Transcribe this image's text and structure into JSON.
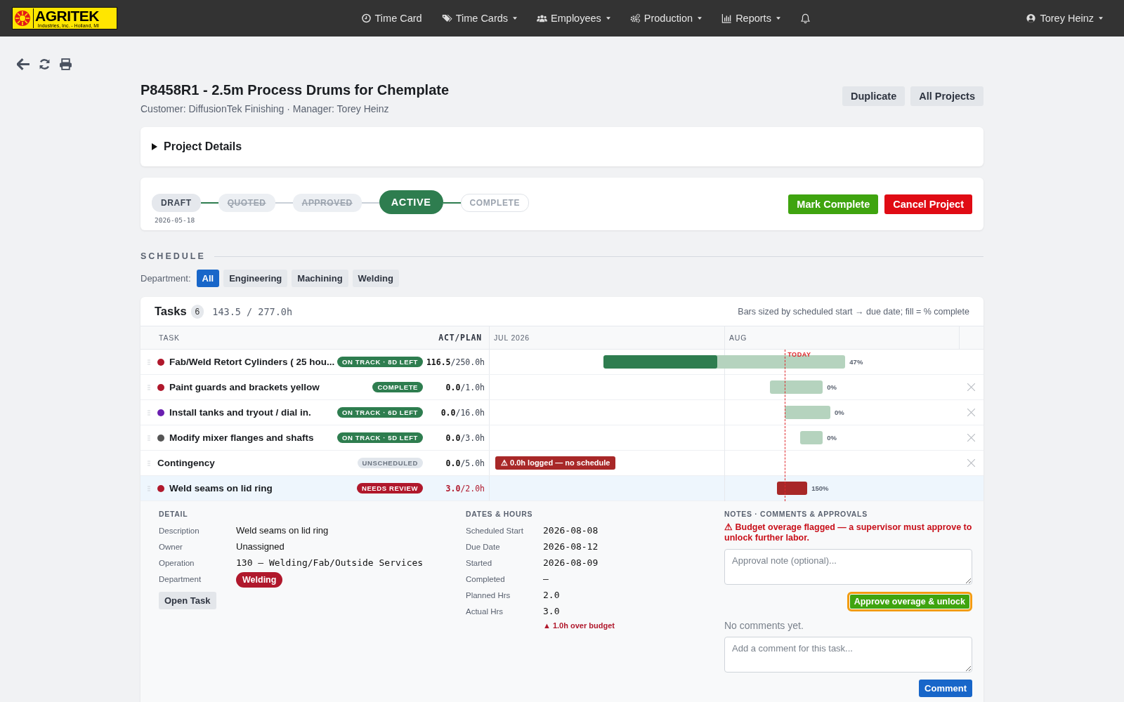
{
  "nav": {
    "logo": {
      "name": "AGRITEK",
      "tagline": "Industries, Inc. - Holland, MI"
    },
    "items": [
      {
        "label": "Time Card",
        "has_menu": false
      },
      {
        "label": "Time Cards",
        "has_menu": true
      },
      {
        "label": "Employees",
        "has_menu": true
      },
      {
        "label": "Production",
        "has_menu": true
      },
      {
        "label": "Reports",
        "has_menu": true
      }
    ],
    "user": {
      "name": "Torey Heinz",
      "has_menu": true
    }
  },
  "project": {
    "title": "P8458R1 - 2.5m Process Drums for Chemplate",
    "subtitle": "Customer: DiffusionTek Finishing · Manager: Torey Heinz",
    "actions": [
      "Duplicate",
      "All Projects"
    ]
  },
  "details": {
    "label": "Project Details",
    "expanded": false
  },
  "workflow": {
    "steps": [
      {
        "label": "DRAFT",
        "completed": true,
        "skipped": false,
        "current": false,
        "date": "2026-05-18"
      },
      {
        "label": "QUOTED",
        "completed": false,
        "skipped": true,
        "current": false
      },
      {
        "label": "APPROVED",
        "completed": false,
        "skipped": true,
        "current": false
      },
      {
        "label": "ACTIVE",
        "completed": false,
        "skipped": false,
        "current": true
      },
      {
        "label": "COMPLETE",
        "completed": false,
        "skipped": false,
        "current": false
      }
    ],
    "actions": [
      {
        "label": "Mark Complete",
        "kind": "success"
      },
      {
        "label": "Cancel Project",
        "kind": "danger"
      }
    ]
  },
  "schedule": {
    "heading": "SCHEDULE",
    "filter_label": "Department:",
    "filters": [
      {
        "label": "All",
        "selected": true
      },
      {
        "label": "Engineering",
        "selected": false
      },
      {
        "label": "Machining",
        "selected": false
      },
      {
        "label": "Welding",
        "selected": false
      }
    ]
  },
  "tasks": {
    "title": "Tasks",
    "count": "6",
    "hours": "143.5 / 277.0h",
    "legend": "Bars sized by scheduled start → due date; fill = % complete",
    "columns": {
      "task": "TASK",
      "hours": "ACT/PLAN"
    },
    "timeline": {
      "today_label": "TODAY",
      "months": [
        "JUL 2026",
        "AUG"
      ]
    },
    "rows": [
      {
        "name": "Fab/Weld Retort Cylinders ( 25 hou...",
        "color": "#b0182c",
        "status": {
          "label": "ON TRACK · 8D LEFT",
          "kind": "on-track"
        },
        "actual": "116.5",
        "plan": "/250.0h",
        "over_budget": false,
        "bar": {
          "level": 0.47,
          "kind": "progress"
        },
        "percent": "47%",
        "removable": false,
        "selected": false
      },
      {
        "name": "Paint guards and brackets yellow",
        "color": "#b0182c",
        "status": {
          "label": "COMPLETE",
          "kind": "complete"
        },
        "actual": "0.0",
        "plan": "/1.0h",
        "over_budget": false,
        "bar": {
          "level": 0,
          "kind": "progress"
        },
        "percent": "0%",
        "removable": true,
        "selected": false
      },
      {
        "name": "Install tanks and tryout / dial in.",
        "color": "#6a1fb0",
        "status": {
          "label": "ON TRACK · 6D LEFT",
          "kind": "on-track"
        },
        "actual": "0.0",
        "plan": "/16.0h",
        "over_budget": false,
        "bar": {
          "level": 0,
          "kind": "progress"
        },
        "percent": "0%",
        "removable": true,
        "selected": false
      },
      {
        "name": "Modify mixer flanges and shafts",
        "color": "#555555",
        "status": {
          "label": "ON TRACK · 5D LEFT",
          "kind": "on-track"
        },
        "actual": "0.0",
        "plan": "/3.0h",
        "over_budget": false,
        "bar": {
          "level": 0,
          "kind": "progress"
        },
        "percent": "0%",
        "removable": true,
        "selected": false
      },
      {
        "name": "Contingency",
        "status": {
          "label": "UNSCHEDULED",
          "kind": "unscheduled"
        },
        "actual": "0.0",
        "plan": "/5.0h",
        "over_budget": false,
        "warning": "⚠ 0.0h logged — no schedule",
        "removable": true,
        "selected": false
      },
      {
        "name": "Weld seams on lid ring",
        "color": "#b0182c",
        "status": {
          "label": "NEEDS REVIEW",
          "kind": "review"
        },
        "actual": "3.0",
        "plan": "/2.0h",
        "over_budget": true,
        "bar": {
          "level": 1,
          "kind": "over"
        },
        "percent": "150%",
        "removable": false,
        "selected": true
      }
    ]
  },
  "detail": {
    "heading": "DETAIL",
    "fields": [
      {
        "label": "Description",
        "value": "Weld seams on lid ring",
        "kind": "text"
      },
      {
        "label": "Owner",
        "value": "Unassigned",
        "kind": "text"
      },
      {
        "label": "Operation",
        "value": "130 – Welding/Fab/Outside Services",
        "kind": "mono"
      },
      {
        "label": "Department",
        "value": "Welding",
        "kind": "tag"
      }
    ],
    "button": "Open Task"
  },
  "dates": {
    "heading": "DATES & HOURS",
    "fields": [
      {
        "label": "Scheduled Start",
        "value": "2026-08-08"
      },
      {
        "label": "Due Date",
        "value": "2026-08-12"
      },
      {
        "label": "Started",
        "value": "2026-08-09"
      },
      {
        "label": "Completed",
        "value": "—"
      },
      {
        "label": "Planned Hrs",
        "value": "2.0"
      },
      {
        "label": "Actual Hrs",
        "value": "3.0"
      }
    ],
    "note": "▲ 1.0h over budget"
  },
  "notes": {
    "heading": "NOTES · COMMENTS & APPROVALS",
    "alert": "⚠ Budget overage flagged — a supervisor must approve to unlock further labor.",
    "approval_placeholder": "Approval note (optional)...",
    "approve_button": {
      "label": "Approve overage & unlock",
      "focused": true
    },
    "empty": "No comments yet.",
    "comment_placeholder": "Add a comment for this task...",
    "comment_button": "Comment"
  }
}
